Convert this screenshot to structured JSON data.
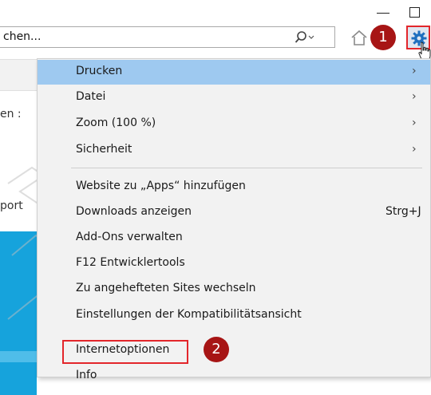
{
  "window": {
    "minimize_icon": "minimize-icon",
    "maximize_icon": "maximize-icon"
  },
  "address_bar": {
    "text": "chen...",
    "search_icon": "search-icon"
  },
  "toolbar": {
    "home_icon": "home-icon",
    "favorites_icon": "star-icon",
    "tools_icon": "gear-icon"
  },
  "callouts": {
    "step1": "1",
    "step2": "2"
  },
  "background_page": {
    "text1": "en :",
    "text2": "port"
  },
  "menu": {
    "items": [
      {
        "label": "Drucken",
        "arrow": "›"
      },
      {
        "label": "Datei",
        "arrow": "›"
      },
      {
        "label": "Zoom (100 %)",
        "arrow": "›"
      },
      {
        "label": "Sicherheit",
        "arrow": "›"
      },
      {
        "label": "Website zu „Apps“ hinzufügen"
      },
      {
        "label": "Downloads anzeigen",
        "shortcut": "Strg+J"
      },
      {
        "label": "Add-Ons verwalten"
      },
      {
        "label": "F12 Entwicklertools"
      },
      {
        "label": "Zu angehefteten Sites wechseln"
      },
      {
        "label": "Einstellungen der Kompatibilitätsansicht"
      },
      {
        "label": "Internetoptionen"
      },
      {
        "label": "Info"
      }
    ]
  },
  "colors": {
    "hover": "#9ec9f0",
    "highlight_border": "#e3262b",
    "callout": "#a71515",
    "page_blue": "#16a3dc"
  }
}
